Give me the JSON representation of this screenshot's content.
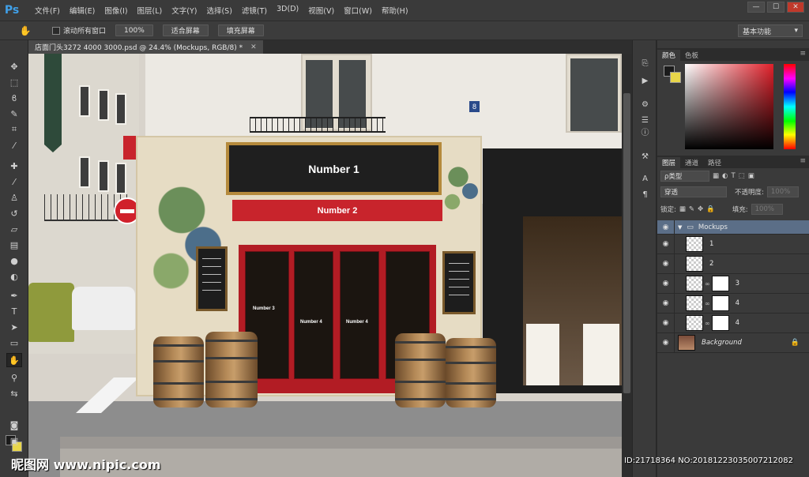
{
  "app": {
    "logo": "Ps"
  },
  "menu": [
    "文件(F)",
    "编辑(E)",
    "图像(I)",
    "图层(L)",
    "文字(Y)",
    "选择(S)",
    "滤镜(T)",
    "3D(D)",
    "视图(V)",
    "窗口(W)",
    "帮助(H)"
  ],
  "window_controls": {
    "minimize": "—",
    "maximize": "☐",
    "close": "✕"
  },
  "options": {
    "scroll_all": "滚动所有窗口",
    "btn_100": "100%",
    "btn_fit": "适合屏幕",
    "btn_fill": "填充屏幕",
    "workspace": "基本功能"
  },
  "document": {
    "tab_title": "店面门头3272 4000 3000.psd @ 24.4% (Mockups, RGB/8) *",
    "close": "✕"
  },
  "mockup": {
    "number1": "Number 1",
    "number2": "Number 2",
    "number3": "Number 3",
    "number4a": "Number 4",
    "number4b": "Number 4",
    "house_number": "8"
  },
  "color_panel": {
    "tabs": [
      "颜色",
      "色板"
    ]
  },
  "layers_panel": {
    "tabs": [
      "图层",
      "通道",
      "路径"
    ],
    "kind_filter": "ρ类型",
    "blend_mode": "穿透",
    "opacity_label": "不透明度:",
    "opacity_value": "100%",
    "lock_label": "锁定:",
    "fill_label": "填充:",
    "fill_value": "100%",
    "layers": [
      {
        "name": "Mockups",
        "type": "group"
      },
      {
        "name": "1",
        "type": "smart"
      },
      {
        "name": "2",
        "type": "smart"
      },
      {
        "name": "3",
        "type": "smart-mask"
      },
      {
        "name": "4",
        "type": "smart-mask"
      },
      {
        "name": "4",
        "type": "smart-mask"
      },
      {
        "name": "Background",
        "type": "background"
      }
    ]
  },
  "watermark": {
    "left": "昵图网 www.nipic.com",
    "right": "ID:21718364 NO:20181223035007212082"
  },
  "colors": {
    "accent": "#40a0e8",
    "sign_red": "#c8242c",
    "frame_gold": "#b58a3c",
    "group_row": "#5b6e87"
  }
}
